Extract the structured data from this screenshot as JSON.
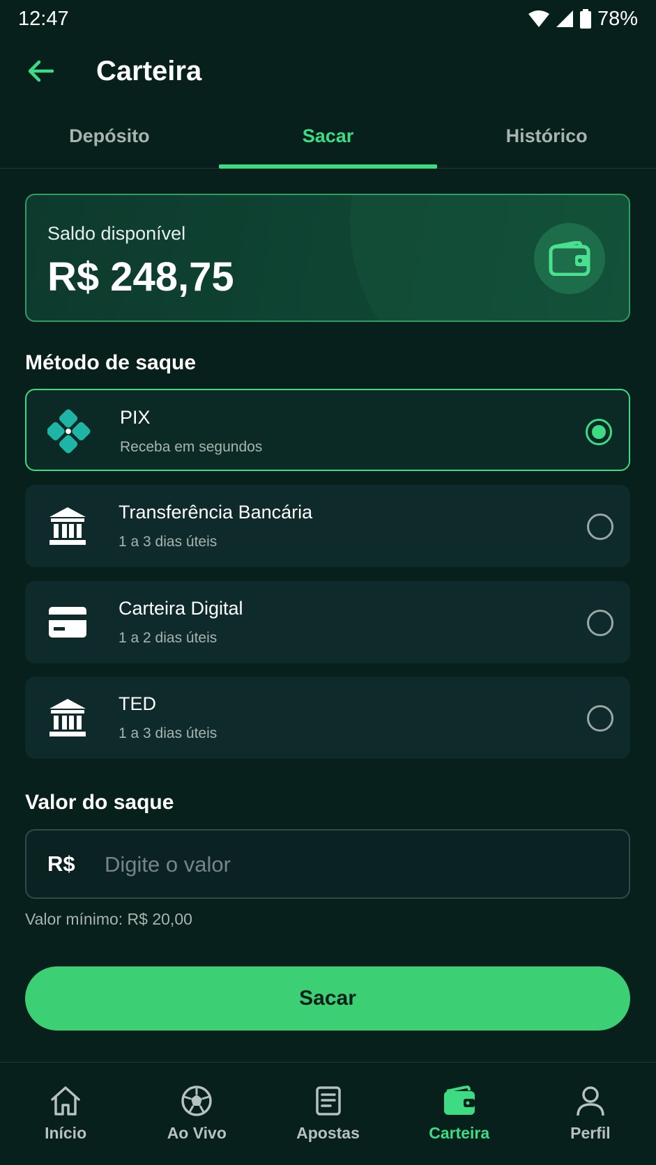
{
  "status_bar": {
    "time": "12:47",
    "battery": "78%"
  },
  "header": {
    "title": "Carteira",
    "back_icon": "arrow-left-icon"
  },
  "tabs": [
    {
      "label": "Depósito",
      "active": false
    },
    {
      "label": "Sacar",
      "active": true
    },
    {
      "label": "Histórico",
      "active": false
    }
  ],
  "balance": {
    "label": "Saldo disponível",
    "value": "R$ 248,75",
    "icon": "wallet-icon"
  },
  "methods_section": {
    "title": "Método de saque"
  },
  "methods": [
    {
      "name": "PIX",
      "sub": "Receba em segundos",
      "icon": "pix-icon",
      "selected": true
    },
    {
      "name": "Transferência Bancária",
      "sub": "1 a 3 dias úteis",
      "icon": "bank-icon",
      "selected": false
    },
    {
      "name": "Carteira Digital",
      "sub": "1 a 2 dias úteis",
      "icon": "card-icon",
      "selected": false
    },
    {
      "name": "TED",
      "sub": "1 a 3 dias úteis",
      "icon": "bank-icon",
      "selected": false
    }
  ],
  "amount_section": {
    "title": "Valor do saque",
    "currency": "R$",
    "placeholder": "Digite o valor",
    "value": "",
    "hint": "Valor mínimo: R$ 20,00"
  },
  "submit_label": "Sacar",
  "bottom_nav": [
    {
      "label": "Início",
      "icon": "home-icon",
      "active": false
    },
    {
      "label": "Ao Vivo",
      "icon": "soccer-ball-icon",
      "active": false
    },
    {
      "label": "Apostas",
      "icon": "ticket-icon",
      "active": false
    },
    {
      "label": "Carteira",
      "icon": "wallet-icon",
      "active": true
    },
    {
      "label": "Perfil",
      "icon": "user-icon",
      "active": false
    }
  ],
  "colors": {
    "accent": "#3ddc84",
    "background": "#07201b",
    "card": "#0e2a2b",
    "muted_text": "#a7b4b0"
  }
}
